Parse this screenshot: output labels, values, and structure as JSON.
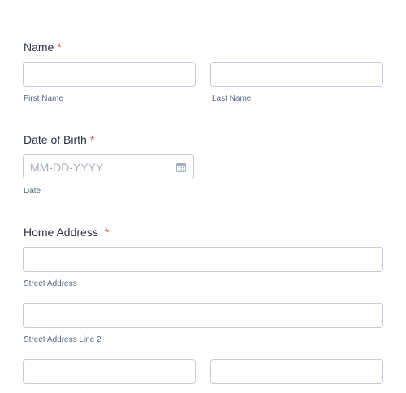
{
  "name": {
    "label": "Name",
    "required_mark": "*",
    "first_sublabel": "First Name",
    "last_sublabel": "Last Name",
    "first_value": "",
    "last_value": ""
  },
  "dob": {
    "label": "Date of Birth",
    "required_mark": "*",
    "placeholder": "MM-DD-YYYY",
    "sublabel": "Date",
    "value": ""
  },
  "address": {
    "label": "Home Address",
    "required_mark": "*",
    "street_sublabel": "Street Address",
    "street2_sublabel": "Street Address Line 2",
    "street_value": "",
    "street2_value": "",
    "city_value": "",
    "state_value": ""
  },
  "icons": {
    "date_picker": "calendar-icon"
  },
  "colors": {
    "required": "#e15252",
    "border": "#c3cad8",
    "label": "#2c3345"
  }
}
